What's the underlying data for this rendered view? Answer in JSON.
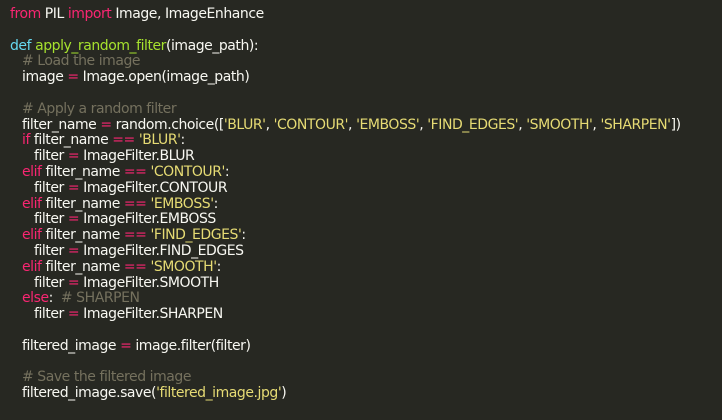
{
  "colors": {
    "background": "#272822",
    "text": "#f8f8f2",
    "keyword": "#f92672",
    "def_keyword": "#66d9ef",
    "function_name": "#a6e22e",
    "string": "#e6db74",
    "comment": "#75715e"
  },
  "code": {
    "l1": {
      "kw1": "from",
      "t1": " PIL ",
      "kw2": "import",
      "t2": " Image, ImageEnhance"
    },
    "l3": {
      "kw": "def",
      "sp": " ",
      "fn": "apply_random_filter",
      "t": "(image_path):"
    },
    "l4": {
      "cm": "# Load the image"
    },
    "l5": {
      "t1": "image ",
      "op": "=",
      "t2": " Image.open(image_path)"
    },
    "l7": {
      "cm": "# Apply a random filter"
    },
    "l8": {
      "t1": "filter_name ",
      "op": "=",
      "t2": " random.choice([",
      "s1": "'BLUR'",
      "c1": ", ",
      "s2": "'CONTOUR'",
      "c2": ", ",
      "s3": "'EMBOSS'",
      "c3": ", ",
      "s4": "'FIND_EDGES'",
      "c4": ", ",
      "s5": "'SMOOTH'",
      "c5": ", ",
      "s6": "'SHARPEN'",
      "t3": "])"
    },
    "l9": {
      "kw": "if",
      "t1": " filter_name ",
      "op": "==",
      "sp": " ",
      "s": "'BLUR'",
      "t2": ":"
    },
    "l10": {
      "t1": "filter ",
      "op": "=",
      "t2": " ImageFilter.BLUR"
    },
    "l11": {
      "kw": "elif",
      "t1": " filter_name ",
      "op": "==",
      "sp": " ",
      "s": "'CONTOUR'",
      "t2": ":"
    },
    "l12": {
      "t1": "filter ",
      "op": "=",
      "t2": " ImageFilter.CONTOUR"
    },
    "l13": {
      "kw": "elif",
      "t1": " filter_name ",
      "op": "==",
      "sp": " ",
      "s": "'EMBOSS'",
      "t2": ":"
    },
    "l14": {
      "t1": "filter ",
      "op": "=",
      "t2": " ImageFilter.EMBOSS"
    },
    "l15": {
      "kw": "elif",
      "t1": " filter_name ",
      "op": "==",
      "sp": " ",
      "s": "'FIND_EDGES'",
      "t2": ":"
    },
    "l16": {
      "t1": "filter ",
      "op": "=",
      "t2": " ImageFilter.FIND_EDGES"
    },
    "l17": {
      "kw": "elif",
      "t1": " filter_name ",
      "op": "==",
      "sp": " ",
      "s": "'SMOOTH'",
      "t2": ":"
    },
    "l18": {
      "t1": "filter ",
      "op": "=",
      "t2": " ImageFilter.SMOOTH"
    },
    "l19": {
      "kw": "else",
      "t": ":  ",
      "cm": "# SHARPEN"
    },
    "l20": {
      "t1": "filter ",
      "op": "=",
      "t2": " ImageFilter.SHARPEN"
    },
    "l22": {
      "t1": "filtered_image ",
      "op": "=",
      "t2": " image.filter(filter)"
    },
    "l24": {
      "cm": "# Save the filtered image"
    },
    "l25": {
      "t1": "filtered_image.save(",
      "s": "'filtered_image.jpg'",
      "t2": ")"
    }
  }
}
